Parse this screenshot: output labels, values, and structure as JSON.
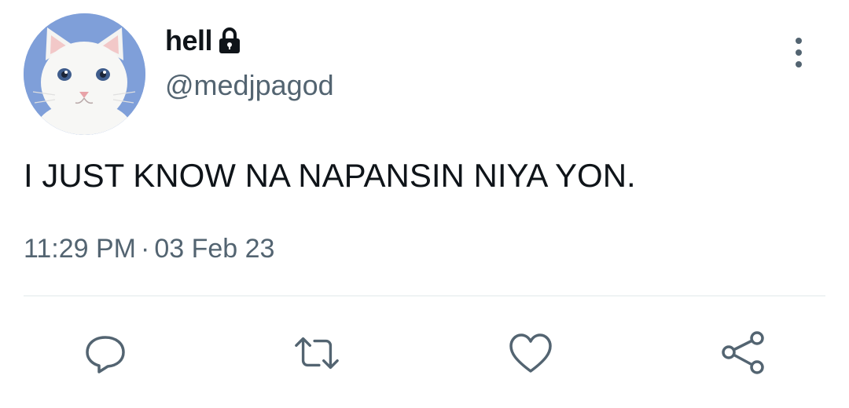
{
  "author": {
    "display_name": "hell",
    "handle": "@medjpagod",
    "avatar_icon": "white-cat-avatar",
    "protected_icon": "lock-icon"
  },
  "tweet": {
    "text": "I JUST KNOW NA NAPANSIN NIYA YON.",
    "time": "11:29 PM",
    "separator": "·",
    "date": "03 Feb 23"
  },
  "actions": [
    {
      "icon": "reply-icon"
    },
    {
      "icon": "retweet-icon"
    },
    {
      "icon": "like-icon"
    },
    {
      "icon": "share-icon"
    }
  ],
  "colors": {
    "text_primary": "#0f1419",
    "text_secondary": "#536471",
    "divider": "#eff3f4",
    "avatar_background": "#7f9fd9"
  }
}
